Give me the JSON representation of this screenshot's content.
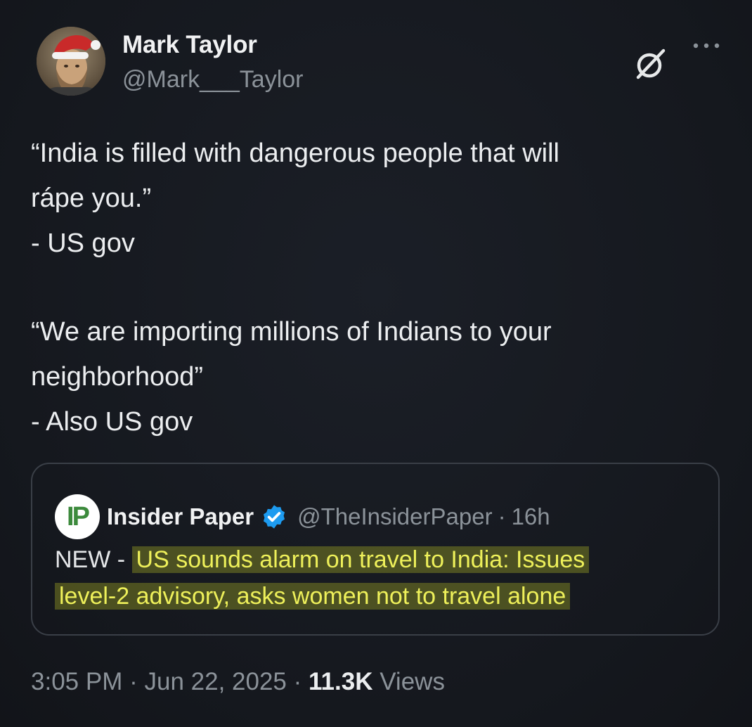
{
  "author": {
    "display_name": "Mark Taylor",
    "handle": "@Mark___Taylor",
    "avatar_icon": "bearded-man-santa-hat-avatar"
  },
  "header_icons": [
    "grok-icon",
    "more-icon"
  ],
  "tweet": {
    "lines": [
      "“India is filled with dangerous people that will",
      "rápe you.”",
      "- US gov",
      "",
      "“We are importing millions of Indians to your",
      "neighborhood”",
      "- Also US gov"
    ]
  },
  "quoted_tweet": {
    "logo_text": "IP",
    "name": "Insider Paper",
    "verified": true,
    "handle": "@TheInsiderPaper",
    "separator": "·",
    "time": "16h",
    "text_prefix": "NEW - ",
    "text_highlight_line1": "US sounds alarm on travel to India: Issues",
    "text_highlight_line2": "level-2 advisory, asks women not to travel alone",
    "highlight_color": "#eef05a"
  },
  "meta": {
    "time": "3:05 PM",
    "separator": "·",
    "date": "Jun 22, 2025",
    "views_count": "11.3K",
    "views_label": "Views"
  },
  "colors": {
    "background": "#16191f",
    "text_primary": "#e7e9ea",
    "text_secondary": "#8b9299",
    "verified_blue": "#1d9bf0"
  }
}
